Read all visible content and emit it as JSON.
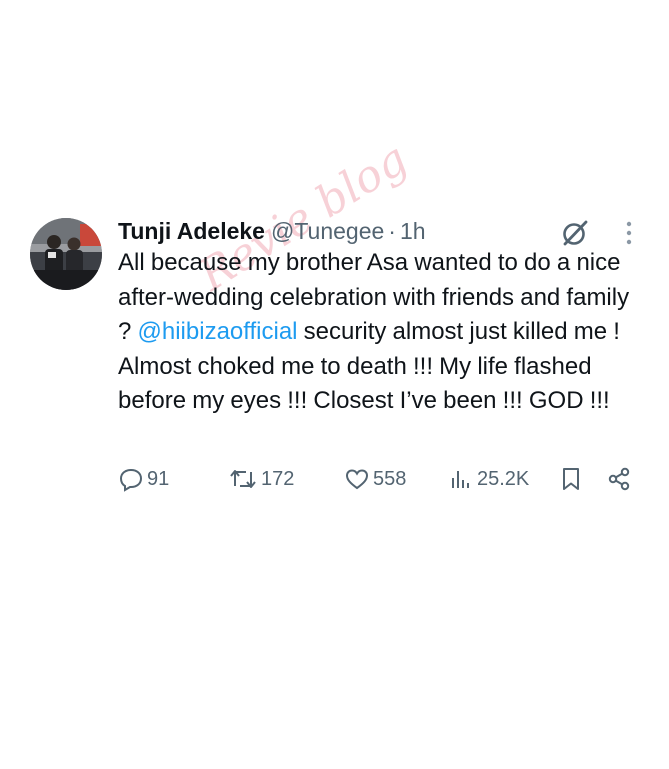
{
  "tweet": {
    "author": {
      "display_name": "Tunji Adeleke",
      "handle": "@Tunegee",
      "separator": "·",
      "time": "1h"
    },
    "text_parts": {
      "before_mention": "All because my brother Asa wanted to do a nice after-wedding celebration with friends and family ? ",
      "mention": "@hiibizaofficial",
      "after_mention": " security almost just killed me ! Almost choked me to death !!! My life flashed before my eyes !!! Closest I’ve been !!! GOD !!!"
    },
    "stats": {
      "replies": "91",
      "reposts": "172",
      "likes": "558",
      "views": "25.2K"
    },
    "icons": {
      "grok": "grok-icon",
      "more": "more-dots-icon",
      "reply": "reply-icon",
      "repost": "repost-icon",
      "like": "heart-icon",
      "views": "views-icon",
      "bookmark": "bookmark-icon",
      "share": "share-icon"
    },
    "colors": {
      "mention": "#1d9bf0",
      "secondary_text": "#536471",
      "primary_text": "#0f1419"
    }
  },
  "watermark": "Revie blog"
}
